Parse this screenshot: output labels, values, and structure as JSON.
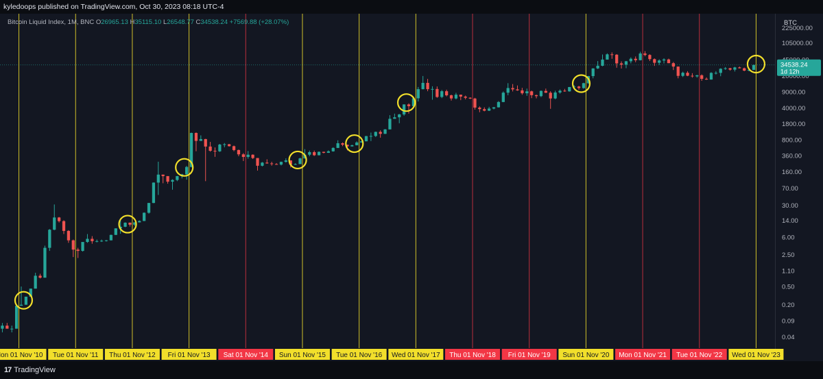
{
  "header": {
    "published": "kyledoops published on TradingView.com, Oct 30, 2023 08:18 UTC-4"
  },
  "legend": {
    "symbol": "Bitcoin Liquid Index, 1M, BNC",
    "o_label": "O",
    "o": "26965.13",
    "h_label": "H",
    "h": "35115.10",
    "l_label": "L",
    "l": "26548.77",
    "c_label": "C",
    "c": "34538.24",
    "change": "+7569.88 (+28.07%)"
  },
  "price_axis": {
    "currency": "BTC",
    "current_price": "34538.24",
    "countdown": "1d 12h"
  },
  "footer": {
    "brand": "TradingView"
  },
  "colors": {
    "background": "#131722",
    "up": "#26a69a",
    "down": "#ef5350",
    "yellow": "#f2df2b",
    "red_marker": "#f23645"
  },
  "chart_data": {
    "type": "candlestick",
    "scale": "log",
    "interval": "1M",
    "ylim": [
      0.025,
      280000
    ],
    "y_ticks": [
      "225000.00",
      "105000.00",
      "45000.00",
      "20000.00",
      "9000.00",
      "4000.00",
      "1800.00",
      "800.00",
      "360.00",
      "160.00",
      "70.00",
      "30.00",
      "14.00",
      "6.00",
      "2.50",
      "1.10",
      "0.50",
      "0.20",
      "0.09",
      "0.04"
    ],
    "xlim": [
      "2010-07-01",
      "2024-03-01"
    ],
    "candles": [
      [
        "2010-07-01",
        0.06,
        0.08,
        0.05,
        0.07
      ],
      [
        "2010-08-01",
        0.07,
        0.08,
        0.06,
        0.06
      ],
      [
        "2010-09-01",
        0.06,
        0.07,
        0.05,
        0.06
      ],
      [
        "2010-10-01",
        0.06,
        0.2,
        0.06,
        0.19
      ],
      [
        "2010-11-01",
        0.19,
        0.5,
        0.19,
        0.2
      ],
      [
        "2010-12-01",
        0.2,
        0.3,
        0.2,
        0.3
      ],
      [
        "2011-01-01",
        0.3,
        0.45,
        0.3,
        0.45
      ],
      [
        "2011-02-01",
        0.45,
        1.0,
        0.45,
        0.86
      ],
      [
        "2011-03-01",
        0.86,
        0.95,
        0.75,
        0.78
      ],
      [
        "2011-04-01",
        0.78,
        3.9,
        0.78,
        3.5
      ],
      [
        "2011-05-01",
        3.5,
        9.0,
        3.0,
        8.7
      ],
      [
        "2011-06-01",
        8.7,
        31.0,
        8.5,
        16.1
      ],
      [
        "2011-07-01",
        16.1,
        16.5,
        12.5,
        13.4
      ],
      [
        "2011-08-01",
        13.4,
        14.0,
        7.0,
        8.2
      ],
      [
        "2011-09-01",
        8.2,
        8.5,
        4.5,
        5.1
      ],
      [
        "2011-10-01",
        5.1,
        5.3,
        2.2,
        3.2
      ],
      [
        "2011-11-01",
        3.2,
        3.5,
        2.1,
        3.0
      ],
      [
        "2011-12-01",
        3.0,
        4.5,
        2.9,
        4.7
      ],
      [
        "2012-01-01",
        4.7,
        7.0,
        4.5,
        5.5
      ],
      [
        "2012-02-01",
        5.5,
        6.3,
        4.3,
        4.9
      ],
      [
        "2012-03-01",
        4.9,
        5.3,
        4.6,
        4.9
      ],
      [
        "2012-04-01",
        4.9,
        5.3,
        4.7,
        5.0
      ],
      [
        "2012-05-01",
        5.0,
        5.2,
        4.8,
        5.1
      ],
      [
        "2012-06-01",
        5.1,
        6.8,
        5.1,
        6.7
      ],
      [
        "2012-07-01",
        6.7,
        9.4,
        6.7,
        9.3
      ],
      [
        "2012-08-01",
        9.3,
        15.4,
        7.1,
        10.1
      ],
      [
        "2012-09-01",
        10.1,
        12.6,
        9.9,
        12.4
      ],
      [
        "2012-10-01",
        12.4,
        12.5,
        10.2,
        11.2
      ],
      [
        "2012-11-01",
        11.2,
        12.7,
        10.5,
        12.6
      ],
      [
        "2012-12-01",
        12.6,
        13.9,
        12.5,
        13.5
      ],
      [
        "2013-01-01",
        13.5,
        20.8,
        13.4,
        20.4
      ],
      [
        "2013-02-01",
        20.4,
        33.4,
        19.5,
        33.4
      ],
      [
        "2013-03-01",
        33.4,
        94.0,
        33.0,
        93.0
      ],
      [
        "2013-04-01",
        93.0,
        266.0,
        50.0,
        139.0
      ],
      [
        "2013-05-01",
        139.0,
        139.0,
        90.0,
        129.0
      ],
      [
        "2013-06-01",
        129.0,
        129.0,
        88.0,
        97.5
      ],
      [
        "2013-07-01",
        97.5,
        110.0,
        65.0,
        106.0
      ],
      [
        "2013-08-01",
        106.0,
        130.0,
        100.0,
        129.0
      ],
      [
        "2013-09-01",
        129.0,
        145.0,
        115.0,
        141.0
      ],
      [
        "2013-10-01",
        141.0,
        215.0,
        108.0,
        204.0
      ],
      [
        "2013-11-01",
        204.0,
        1150.0,
        200.0,
        1129.0
      ],
      [
        "2013-12-01",
        1129.0,
        1160.0,
        450.0,
        757.0
      ],
      [
        "2014-01-01",
        757.0,
        1000.0,
        760.0,
        830.0
      ],
      [
        "2014-02-01",
        830.0,
        840.0,
        100.0,
        570.0
      ],
      [
        "2014-03-01",
        570.0,
        720.0,
        440.0,
        460.0
      ],
      [
        "2014-04-01",
        460.0,
        545.0,
        340.0,
        448.0
      ],
      [
        "2014-05-01",
        448.0,
        650.0,
        435.0,
        630.0
      ],
      [
        "2014-06-01",
        630.0,
        680.0,
        550.0,
        640.0
      ],
      [
        "2014-07-01",
        640.0,
        650.0,
        570.0,
        580.0
      ],
      [
        "2014-08-01",
        580.0,
        600.0,
        450.0,
        478.0
      ],
      [
        "2014-09-01",
        478.0,
        490.0,
        350.0,
        385.0
      ],
      [
        "2014-10-01",
        385.0,
        410.0,
        275.0,
        338.0
      ],
      [
        "2014-11-01",
        338.0,
        455.0,
        310.0,
        378.0
      ],
      [
        "2014-12-01",
        378.0,
        385.0,
        305.0,
        320.0
      ],
      [
        "2015-01-01",
        320.0,
        320.0,
        170.0,
        217.0
      ],
      [
        "2015-02-01",
        217.0,
        262.0,
        210.0,
        254.0
      ],
      [
        "2015-03-01",
        254.0,
        300.0,
        240.0,
        244.0
      ],
      [
        "2015-04-01",
        244.0,
        265.0,
        218.0,
        236.0
      ],
      [
        "2015-05-01",
        236.0,
        248.0,
        228.0,
        230.0
      ],
      [
        "2015-06-01",
        230.0,
        267.0,
        220.0,
        264.0
      ],
      [
        "2015-07-01",
        264.0,
        315.0,
        254.0,
        284.0
      ],
      [
        "2015-08-01",
        284.0,
        285.0,
        199.0,
        230.0
      ],
      [
        "2015-09-01",
        230.0,
        245.0,
        226.0,
        236.0
      ],
      [
        "2015-10-01",
        236.0,
        325.0,
        236.0,
        314.0
      ],
      [
        "2015-11-01",
        314.0,
        500.0,
        310.0,
        378.0
      ],
      [
        "2015-12-01",
        378.0,
        465.0,
        350.0,
        430.0
      ],
      [
        "2016-01-01",
        430.0,
        465.0,
        355.0,
        368.0
      ],
      [
        "2016-02-01",
        368.0,
        445.0,
        365.0,
        437.0
      ],
      [
        "2016-03-01",
        437.0,
        440.0,
        405.0,
        416.0
      ],
      [
        "2016-04-01",
        416.0,
        470.0,
        413.0,
        448.0
      ],
      [
        "2016-05-01",
        448.0,
        550.0,
        440.0,
        531.0
      ],
      [
        "2016-06-01",
        531.0,
        780.0,
        530.0,
        673.0
      ],
      [
        "2016-07-01",
        673.0,
        700.0,
        580.0,
        624.0
      ],
      [
        "2016-08-01",
        624.0,
        625.0,
        470.0,
        575.0
      ],
      [
        "2016-09-01",
        575.0,
        625.0,
        570.0,
        609.0
      ],
      [
        "2016-10-01",
        609.0,
        740.0,
        605.0,
        700.0
      ],
      [
        "2016-11-01",
        700.0,
        755.0,
        685.0,
        742.0
      ],
      [
        "2016-12-01",
        742.0,
        975.0,
        740.0,
        963.0
      ],
      [
        "2017-01-01",
        963.0,
        1150.0,
        750.0,
        970.0
      ],
      [
        "2017-02-01",
        970.0,
        1210.0,
        920.0,
        1190.0
      ],
      [
        "2017-03-01",
        1190.0,
        1290.0,
        890.0,
        1080.0
      ],
      [
        "2017-04-01",
        1080.0,
        1370.0,
        1070.0,
        1350.0
      ],
      [
        "2017-05-01",
        1350.0,
        2760.0,
        1350.0,
        2300.0
      ],
      [
        "2017-06-01",
        2300.0,
        2980.0,
        2300.0,
        2480.0
      ],
      [
        "2017-07-01",
        2480.0,
        2940.0,
        1840.0,
        2870.0
      ],
      [
        "2017-08-01",
        2870.0,
        4750.0,
        2680.0,
        4740.0
      ],
      [
        "2017-09-01",
        4740.0,
        5000.0,
        2980.0,
        4340.0
      ],
      [
        "2017-10-01",
        4340.0,
        6470.0,
        4160.0,
        6450.0
      ],
      [
        "2017-11-01",
        6450.0,
        11400.0,
        5500.0,
        10200.0
      ],
      [
        "2017-12-01",
        10200.0,
        19800.0,
        10100.0,
        14000.0
      ],
      [
        "2018-01-01",
        14000.0,
        17100.0,
        9200.0,
        10200.0
      ],
      [
        "2018-02-01",
        10200.0,
        11800.0,
        6000.0,
        10300.0
      ],
      [
        "2018-03-01",
        10300.0,
        11700.0,
        6600.0,
        6900.0
      ],
      [
        "2018-04-01",
        6900.0,
        9800.0,
        6500.0,
        9200.0
      ],
      [
        "2018-05-01",
        9200.0,
        9950.0,
        7100.0,
        7500.0
      ],
      [
        "2018-06-01",
        7500.0,
        7760.0,
        5750.0,
        6400.0
      ],
      [
        "2018-07-01",
        6400.0,
        8490.0,
        6100.0,
        7730.0
      ],
      [
        "2018-08-01",
        7730.0,
        7760.0,
        5880.0,
        7030.0
      ],
      [
        "2018-09-01",
        7030.0,
        7400.0,
        6100.0,
        6630.0
      ],
      [
        "2018-10-01",
        6630.0,
        6780.0,
        6200.0,
        6370.0
      ],
      [
        "2018-11-01",
        6370.0,
        6600.0,
        3650.0,
        4040.0
      ],
      [
        "2018-12-01",
        4040.0,
        4300.0,
        3200.0,
        3740.0
      ],
      [
        "2019-01-01",
        3740.0,
        4100.0,
        3350.0,
        3460.0
      ],
      [
        "2019-02-01",
        3460.0,
        4200.0,
        3400.0,
        3850.0
      ],
      [
        "2019-03-01",
        3850.0,
        4150.0,
        3700.0,
        4100.0
      ],
      [
        "2019-04-01",
        4100.0,
        5600.0,
        4050.0,
        5350.0
      ],
      [
        "2019-05-01",
        5350.0,
        9100.0,
        5300.0,
        8550.0
      ],
      [
        "2019-06-01",
        8550.0,
        13800.0,
        7500.0,
        10800.0
      ],
      [
        "2019-07-01",
        10800.0,
        13200.0,
        9100.0,
        10100.0
      ],
      [
        "2019-08-01",
        10100.0,
        12300.0,
        9400.0,
        9600.0
      ],
      [
        "2019-09-01",
        9600.0,
        10900.0,
        7700.0,
        8300.0
      ],
      [
        "2019-10-01",
        8300.0,
        10500.0,
        7300.0,
        9150.0
      ],
      [
        "2019-11-01",
        9150.0,
        9500.0,
        6500.0,
        7550.0
      ],
      [
        "2019-12-01",
        7550.0,
        7750.0,
        6430.0,
        7190.0
      ],
      [
        "2020-01-01",
        7190.0,
        9580.0,
        6850.0,
        9350.0
      ],
      [
        "2020-02-01",
        9350.0,
        10500.0,
        8450.0,
        8530.0
      ],
      [
        "2020-03-01",
        8530.0,
        9200.0,
        3800.0,
        6400.0
      ],
      [
        "2020-04-01",
        6400.0,
        9450.0,
        6150.0,
        8630.0
      ],
      [
        "2020-05-01",
        8630.0,
        10070.0,
        8120.0,
        9450.0
      ],
      [
        "2020-06-01",
        9450.0,
        10350.0,
        8950.0,
        9140.0
      ],
      [
        "2020-07-01",
        9140.0,
        11400.0,
        8990.0,
        11350.0
      ],
      [
        "2020-08-01",
        11350.0,
        12470.0,
        10600.0,
        11650.0
      ],
      [
        "2020-09-01",
        11650.0,
        12060.0,
        9900.0,
        10780.0
      ],
      [
        "2020-10-01",
        10780.0,
        14100.0,
        10400.0,
        13800.0
      ],
      [
        "2020-11-01",
        13800.0,
        19900.0,
        13200.0,
        19700.0
      ],
      [
        "2020-12-01",
        19700.0,
        29300.0,
        17600.0,
        28950.0
      ],
      [
        "2021-01-01",
        28950.0,
        41950.0,
        28100.0,
        33100.0
      ],
      [
        "2021-02-01",
        33100.0,
        58350.0,
        32300.0,
        45200.0
      ],
      [
        "2021-03-01",
        45200.0,
        61780.0,
        45000.0,
        58800.0
      ],
      [
        "2021-04-01",
        58800.0,
        64900.0,
        47000.0,
        57700.0
      ],
      [
        "2021-05-01",
        57700.0,
        59500.0,
        30000.0,
        37300.0
      ],
      [
        "2021-06-01",
        37300.0,
        41300.0,
        28800.0,
        35000.0
      ],
      [
        "2021-07-01",
        35000.0,
        42300.0,
        29300.0,
        41500.0
      ],
      [
        "2021-08-01",
        41500.0,
        50500.0,
        37400.0,
        47100.0
      ],
      [
        "2021-09-01",
        47100.0,
        52900.0,
        39600.0,
        43800.0
      ],
      [
        "2021-10-01",
        43800.0,
        67000.0,
        43300.0,
        61300.0
      ],
      [
        "2021-11-01",
        61300.0,
        69000.0,
        53300.0,
        57000.0
      ],
      [
        "2021-12-01",
        57000.0,
        59100.0,
        42000.0,
        46200.0
      ],
      [
        "2022-01-01",
        46200.0,
        47900.0,
        32900.0,
        38500.0
      ],
      [
        "2022-02-01",
        38500.0,
        45800.0,
        34300.0,
        43200.0
      ],
      [
        "2022-03-01",
        43200.0,
        48200.0,
        37200.0,
        45500.0
      ],
      [
        "2022-04-01",
        45500.0,
        47400.0,
        37700.0,
        37700.0
      ],
      [
        "2022-05-01",
        37700.0,
        40000.0,
        26700.0,
        31800.0
      ],
      [
        "2022-06-01",
        31800.0,
        31900.0,
        17600.0,
        19900.0
      ],
      [
        "2022-07-01",
        19900.0,
        24600.0,
        18800.0,
        23300.0
      ],
      [
        "2022-08-01",
        23300.0,
        25200.0,
        19600.0,
        20050.0
      ],
      [
        "2022-09-01",
        20050.0,
        22800.0,
        18200.0,
        19420.0
      ],
      [
        "2022-10-01",
        19420.0,
        20980.0,
        18200.0,
        20500.0
      ],
      [
        "2022-11-01",
        20500.0,
        21450.0,
        15500.0,
        17160.0
      ],
      [
        "2022-12-01",
        17160.0,
        18400.0,
        16300.0,
        16540.0
      ],
      [
        "2023-01-01",
        16540.0,
        23950.0,
        16500.0,
        23130.0
      ],
      [
        "2023-02-01",
        23130.0,
        25250.0,
        21350.0,
        23150.0
      ],
      [
        "2023-03-01",
        23150.0,
        29200.0,
        19570.0,
        28480.0
      ],
      [
        "2023-04-01",
        28480.0,
        31000.0,
        26950.0,
        29240.0
      ],
      [
        "2023-05-01",
        29240.0,
        29830.0,
        25870.0,
        27210.0
      ],
      [
        "2023-06-01",
        27210.0,
        31430.0,
        24800.0,
        30480.0
      ],
      [
        "2023-07-01",
        30480.0,
        31800.0,
        28860.0,
        29230.0
      ],
      [
        "2023-08-01",
        29230.0,
        30200.0,
        25170.0,
        25940.0
      ],
      [
        "2023-09-01",
        25940.0,
        27480.0,
        24930.0,
        26970.0
      ],
      [
        "2023-10-01",
        26965.13,
        35115.1,
        26548.77,
        34538.24
      ]
    ],
    "vertical_markers": [
      {
        "date": "2010-11-01",
        "label": "Mon 01 Nov '10",
        "color": "yellow"
      },
      {
        "date": "2011-11-01",
        "label": "Tue 01 Nov '11",
        "color": "yellow"
      },
      {
        "date": "2012-11-01",
        "label": "Thu 01 Nov '12",
        "color": "yellow"
      },
      {
        "date": "2013-11-01",
        "label": "Fri 01 Nov '13",
        "color": "yellow"
      },
      {
        "date": "2014-11-01",
        "label": "Sat 01 Nov '14",
        "color": "red"
      },
      {
        "date": "2015-11-01",
        "label": "Sun 01 Nov '15",
        "color": "yellow"
      },
      {
        "date": "2016-11-01",
        "label": "Tue 01 Nov '16",
        "color": "yellow"
      },
      {
        "date": "2017-11-01",
        "label": "Wed 01 Nov '17",
        "color": "yellow"
      },
      {
        "date": "2018-11-01",
        "label": "Thu 01 Nov '18",
        "color": "red"
      },
      {
        "date": "2019-11-01",
        "label": "Fri 01 Nov '19",
        "color": "red"
      },
      {
        "date": "2020-11-01",
        "label": "Sun 01 Nov '20",
        "color": "yellow"
      },
      {
        "date": "2021-11-01",
        "label": "Mon 01 Nov '21",
        "color": "red"
      },
      {
        "date": "2022-11-01",
        "label": "Tue 01 Nov '22",
        "color": "red"
      },
      {
        "date": "2023-11-01",
        "label": "Wed 01 Nov '23",
        "color": "yellow"
      }
    ],
    "highlight_circles": [
      {
        "date": "2010-12-01",
        "value": 0.25
      },
      {
        "date": "2012-10-01",
        "value": 11.5
      },
      {
        "date": "2013-10-01",
        "value": 200
      },
      {
        "date": "2015-10-01",
        "value": 290
      },
      {
        "date": "2016-10-01",
        "value": 660
      },
      {
        "date": "2017-09-01",
        "value": 5200
      },
      {
        "date": "2020-10-01",
        "value": 13500
      },
      {
        "date": "2023-11-01",
        "value": 36000
      }
    ],
    "current_price_line": 34538.24
  }
}
